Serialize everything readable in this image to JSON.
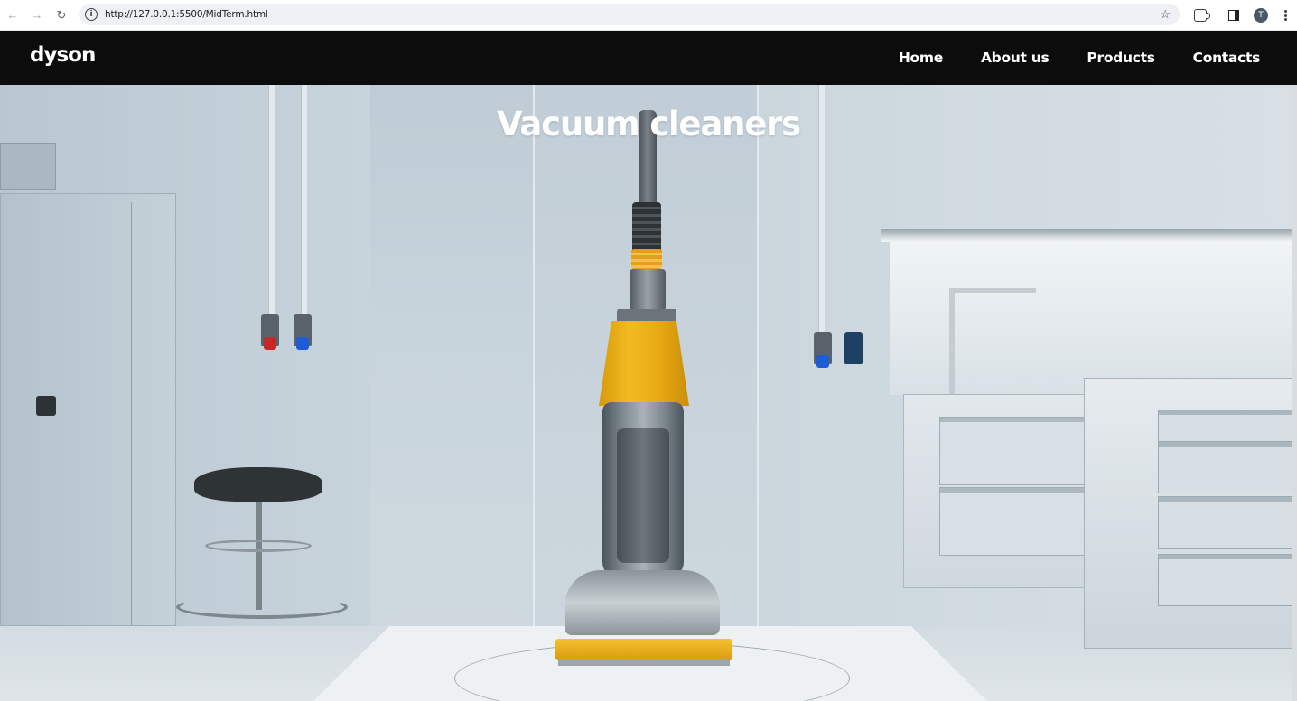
{
  "browser": {
    "url": "http://127.0.0.1:5500/MidTerm.html",
    "profile_initial": "T"
  },
  "site": {
    "logo": "dyson",
    "nav": [
      {
        "label": "Home"
      },
      {
        "label": "About us"
      },
      {
        "label": "Products"
      },
      {
        "label": "Contacts"
      }
    ]
  },
  "hero": {
    "title": "Vacuum cleaners"
  },
  "icons": {
    "back": "arrow-left-icon",
    "forward": "arrow-right-icon",
    "reload": "reload-icon",
    "site_info": "info-icon",
    "bookmark": "star-icon",
    "extensions": "puzzle-icon",
    "side_panel": "side-panel-icon",
    "menu": "kebab-menu-icon",
    "scroll_top": "chevron-up-icon"
  },
  "colors": {
    "header_bg": "#0c0c0c",
    "accent_yellow": "#f2bb22"
  }
}
